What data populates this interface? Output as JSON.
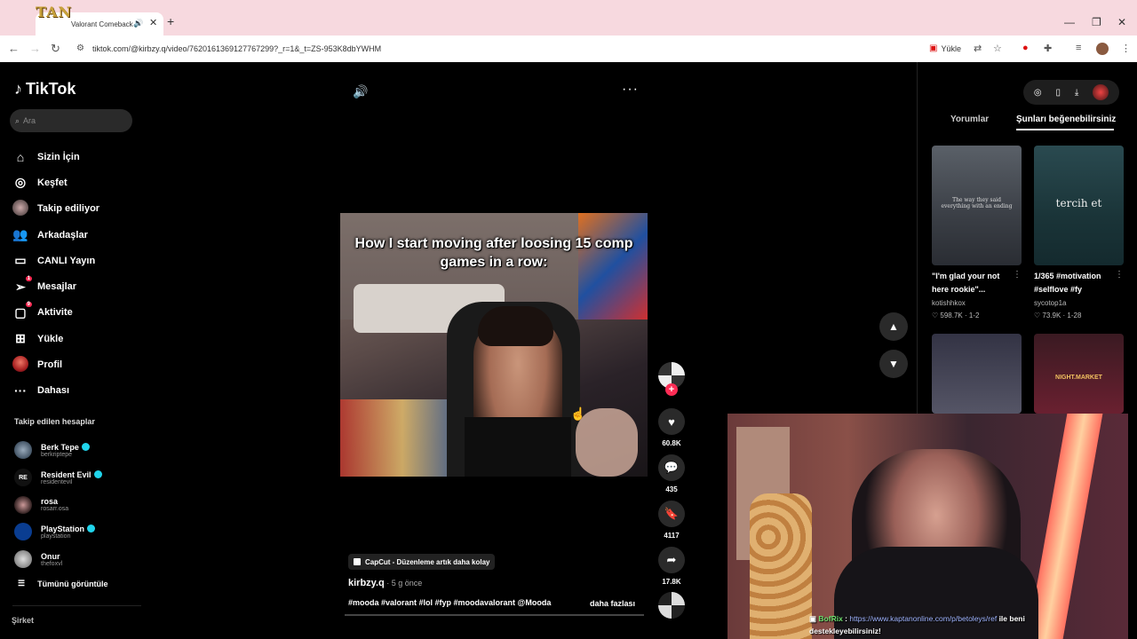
{
  "browser": {
    "overlay_logo": "TAN",
    "tab_title": "Valorant Comeback",
    "url": "tiktok.com/@kirbzy.q/video/7620161369127767299?_r=1&_t=ZS-953K8dbYWHM",
    "upload_chip": "Yükle"
  },
  "sidebar": {
    "logo": "TikTok",
    "search_placeholder": "Ara",
    "items": [
      {
        "label": "Sizin İçin",
        "icon": "home-icon"
      },
      {
        "label": "Keşfet",
        "icon": "compass-icon"
      },
      {
        "label": "Takip ediliyor",
        "icon": "following-avatar-icon"
      },
      {
        "label": "Arkadaşlar",
        "icon": "friends-icon"
      },
      {
        "label": "CANLI Yayın",
        "icon": "live-icon"
      },
      {
        "label": "Mesajlar",
        "icon": "message-icon",
        "badge": "1"
      },
      {
        "label": "Aktivite",
        "icon": "activity-icon",
        "badge": "9"
      },
      {
        "label": "Yükle",
        "icon": "upload-icon"
      },
      {
        "label": "Profil",
        "icon": "profile-avatar-icon"
      },
      {
        "label": "Dahası",
        "icon": "more-dots-icon"
      }
    ],
    "following_title": "Takip edilen hesaplar",
    "following": [
      {
        "name": "Berk Tepe",
        "handle": "berkriptepe",
        "verified": true
      },
      {
        "name": "Resident Evil",
        "handle": "residentevil",
        "verified": true,
        "avatar_text": "RE"
      },
      {
        "name": "rosa",
        "handle": "rosarr.osa",
        "verified": false
      },
      {
        "name": "PlayStation",
        "handle": "playstation",
        "verified": true
      },
      {
        "name": "Onur",
        "handle": "thefoxvl",
        "verified": false
      }
    ],
    "see_all": "Tümünü görüntüle",
    "company": "Şirket"
  },
  "video": {
    "caption": "How I start moving after loosing 15 comp games in a row:",
    "capcut_label": "CapCut - Düzenleme artık daha kolay",
    "author": "kirbzy.q",
    "time": " · 5 g önce",
    "tags": "#mooda #valorant #lol #fyp #moodavalorant @Mooda",
    "more": "daha fazlası"
  },
  "actions": {
    "likes": "60.8K",
    "comments": "435",
    "saves": "4117",
    "shares": "17.8K"
  },
  "right_panel": {
    "tab_comments": "Yorumlar",
    "tab_like": "Şunları beğenebilirsiniz",
    "videos": [
      {
        "title": "\"I'm glad your not here rookie\"...",
        "user": "kotishhkox",
        "likes": "598.7K",
        "date": "1-2",
        "thumb_text": "The way they said everything with an ending"
      },
      {
        "title": "1/365 #motivation #selflove #fy",
        "user": "sycotop1a",
        "likes": "73.9K",
        "date": "1-28",
        "thumb_text": "tercih et"
      },
      {
        "title": "",
        "user": "",
        "likes": "",
        "date": "",
        "thumb_text": ""
      },
      {
        "title": "",
        "user": "",
        "likes": "",
        "date": "",
        "thumb_text": "NIGHT.MARKET"
      }
    ]
  },
  "stream_chat": {
    "user": "BofRix",
    "sep": " : ",
    "link": "https://www.kaptanonline.com/p/betoleys/ref",
    "text_after_link": " ile beni",
    "line2": "destekleyebilirsiniz!"
  }
}
